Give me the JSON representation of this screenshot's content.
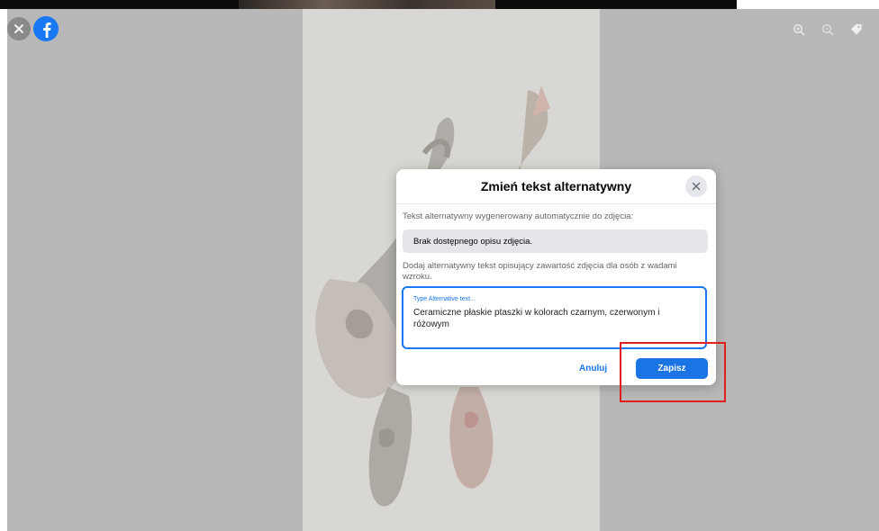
{
  "viewer": {
    "close_icon": "close-icon",
    "logo_icon": "facebook-logo-icon",
    "tools": [
      {
        "name": "zoom-in-icon"
      },
      {
        "name": "zoom-out-icon"
      },
      {
        "name": "tag-icon"
      }
    ]
  },
  "dialog": {
    "title": "Zmień tekst alternatywny",
    "auto_label": "Tekst alternatywny wygenerowany automatycznie do zdjęcia:",
    "auto_value": "Brak dostępnego opisu zdjęcia.",
    "add_label": "Dodaj alternatywny tekst opisujący zawartość zdjęcia dla osób z wadami wzroku.",
    "field_label": "Type Alternative text...",
    "field_value": "Ceramiczne płaskie ptaszki w kolorach czarnym, czerwonym i różowym",
    "cancel_label": "Anuluj",
    "save_label": "Zapisz"
  },
  "colors": {
    "accent": "#1877f2",
    "highlight": "#e02020",
    "overlay": "#b8b8b8"
  }
}
